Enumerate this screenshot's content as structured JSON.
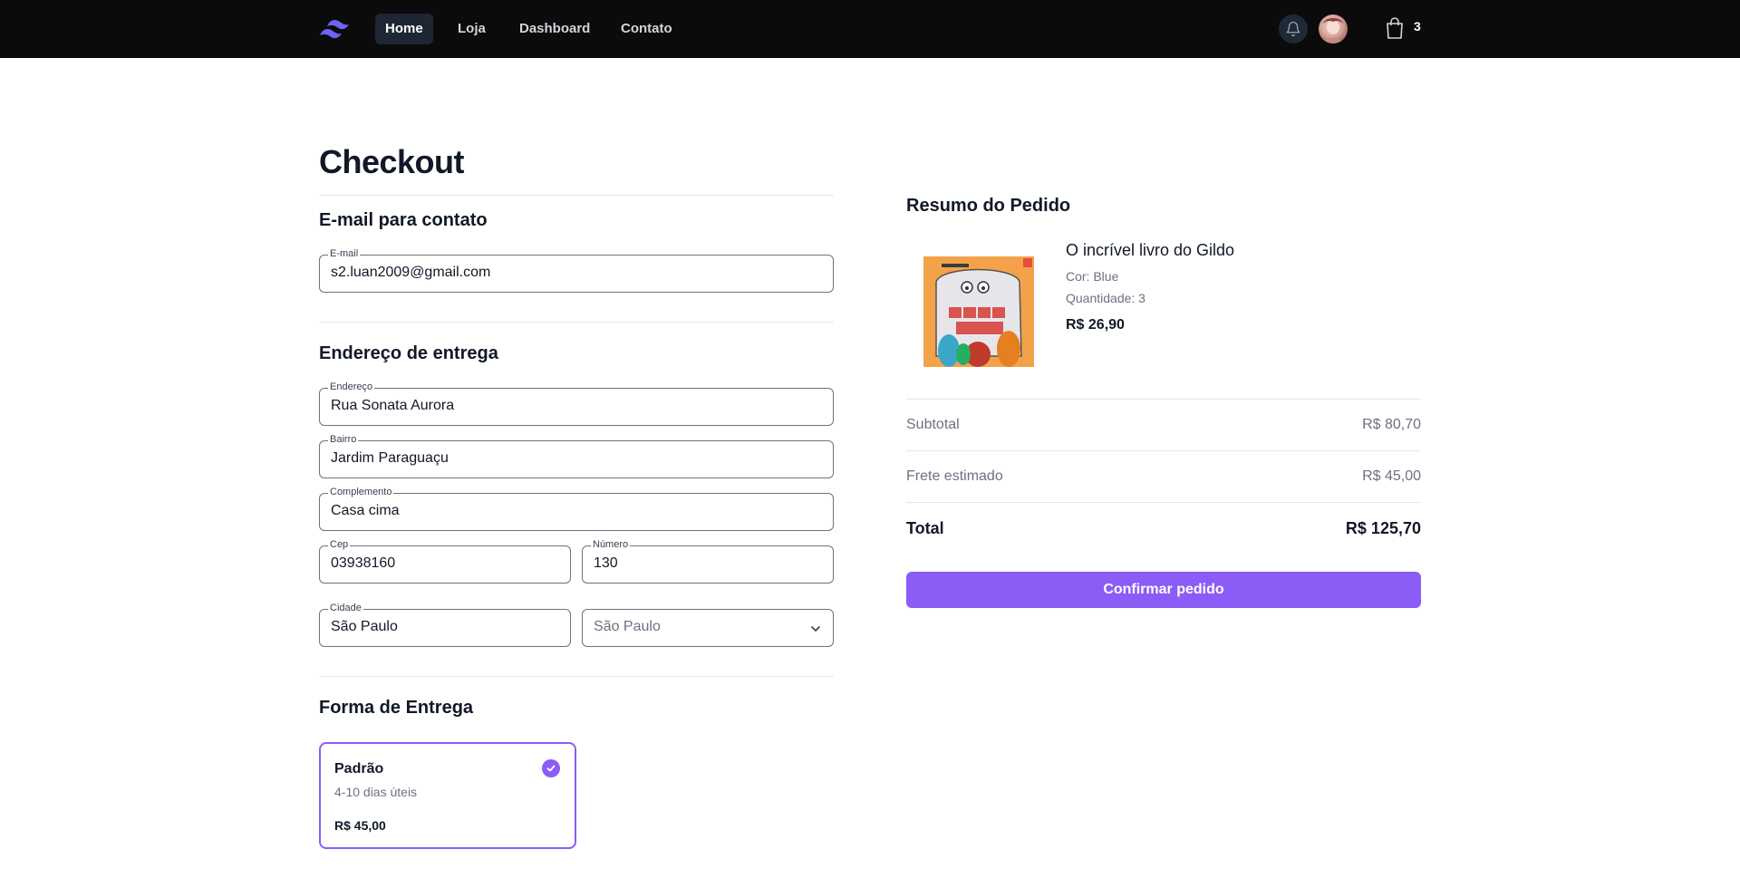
{
  "nav": {
    "items": [
      {
        "label": "Home",
        "active": true
      },
      {
        "label": "Loja",
        "active": false
      },
      {
        "label": "Dashboard",
        "active": false
      },
      {
        "label": "Contato",
        "active": false
      }
    ],
    "cart_count": "3",
    "icons": {
      "logo": "tailwind-logo",
      "bell": "bell-icon",
      "cart": "shopping-bag-icon",
      "avatar": "user-avatar"
    }
  },
  "checkout": {
    "title": "Checkout",
    "contact": {
      "section_title": "E-mail para contato",
      "email_label": "E-mail",
      "email_value": "s2.luan2009@gmail.com"
    },
    "address": {
      "section_title": "Endereço de entrega",
      "endereco_label": "Endereço",
      "endereco_value": "Rua Sonata Aurora",
      "bairro_label": "Bairro",
      "bairro_value": "Jardim Paraguaçu",
      "complemento_label": "Complemento",
      "complemento_value": "Casa cima",
      "cep_label": "Cep",
      "cep_value": "03938160",
      "numero_label": "Número",
      "numero_value": "130",
      "cidade_label": "Cidade",
      "cidade_value": "São Paulo",
      "estado_value": "São Paulo"
    },
    "shipping": {
      "section_title": "Forma de Entrega",
      "option_name": "Padrão",
      "option_time": "4-10 dias úteis",
      "option_price": "R$ 45,00",
      "selected": true
    }
  },
  "summary": {
    "title": "Resumo do Pedido",
    "product": {
      "name": "O incrível livro do Gildo",
      "color": "Cor: Blue",
      "quantity": "Quantidade: 3",
      "price": "R$ 26,90"
    },
    "subtotal_label": "Subtotal",
    "subtotal_value": "R$ 80,70",
    "shipping_label": "Frete estimado",
    "shipping_value": "R$ 45,00",
    "total_label": "Total",
    "total_value": "R$ 125,70",
    "confirm_label": "Confirmar pedido"
  },
  "colors": {
    "accent": "#8b5cf6",
    "navbar_bg": "#0b0b0c",
    "active_nav_bg": "#1f2633"
  }
}
